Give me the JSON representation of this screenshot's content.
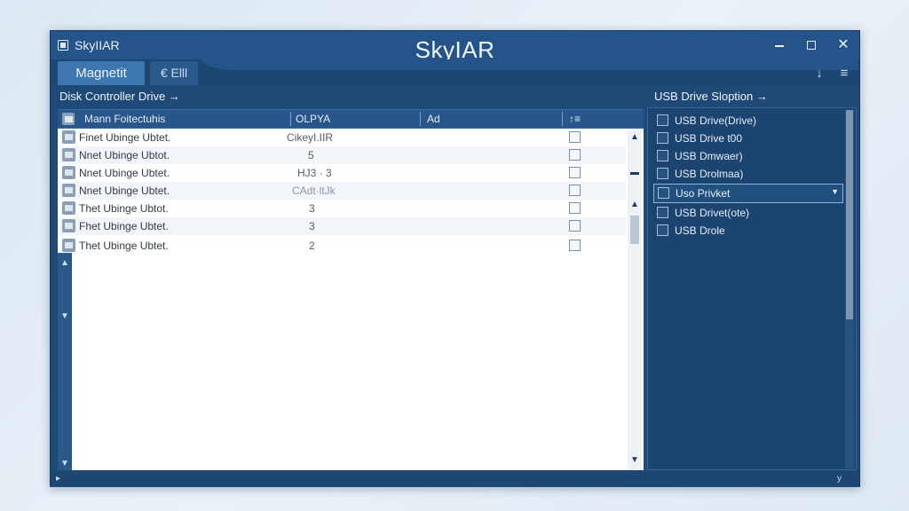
{
  "window": {
    "title_small": "SkyIIAR",
    "title_center": "SkyIAR"
  },
  "tabs": [
    {
      "label": "Magnetit"
    },
    {
      "label": "€ Elll"
    }
  ],
  "left_panel": {
    "title": "Disk Controller Drive →",
    "columns": [
      "Mann Foitectuhis",
      "OLPYA",
      "Ad",
      "↑≡"
    ],
    "rows": [
      {
        "name": "Finet Ubinge Ubtet.",
        "value": "CikeyI.IIR"
      },
      {
        "name": "Nnet Ubinge Ubtot.",
        "value": "5"
      },
      {
        "name": "Nnet Ubinge Ubtet.",
        "value": "HJ3 · 3"
      },
      {
        "name": "Nnet Ubinge Ubtet.",
        "value": "CAdt·ltJk"
      },
      {
        "name": "Thet Ubinge Ubtot.",
        "value": "3"
      },
      {
        "name": "Fhet Ubinge Ubtet.",
        "value": "3"
      },
      {
        "name": "Thet Ubinge Ubtet.",
        "value": "2"
      }
    ]
  },
  "right_panel": {
    "title": "USB Drive Sloption →",
    "items": [
      {
        "label": "USB Drive(Drive)"
      },
      {
        "label": "USB Drive t00"
      },
      {
        "label": "USB Dmwaer)"
      },
      {
        "label": "USB Drolmaa)"
      },
      {
        "label": "Uso Privket"
      },
      {
        "label": "USB Drivet(ote)"
      },
      {
        "label": "USB Drole"
      }
    ]
  },
  "status": {
    "left_arrow": "▸",
    "right_text": "y"
  }
}
